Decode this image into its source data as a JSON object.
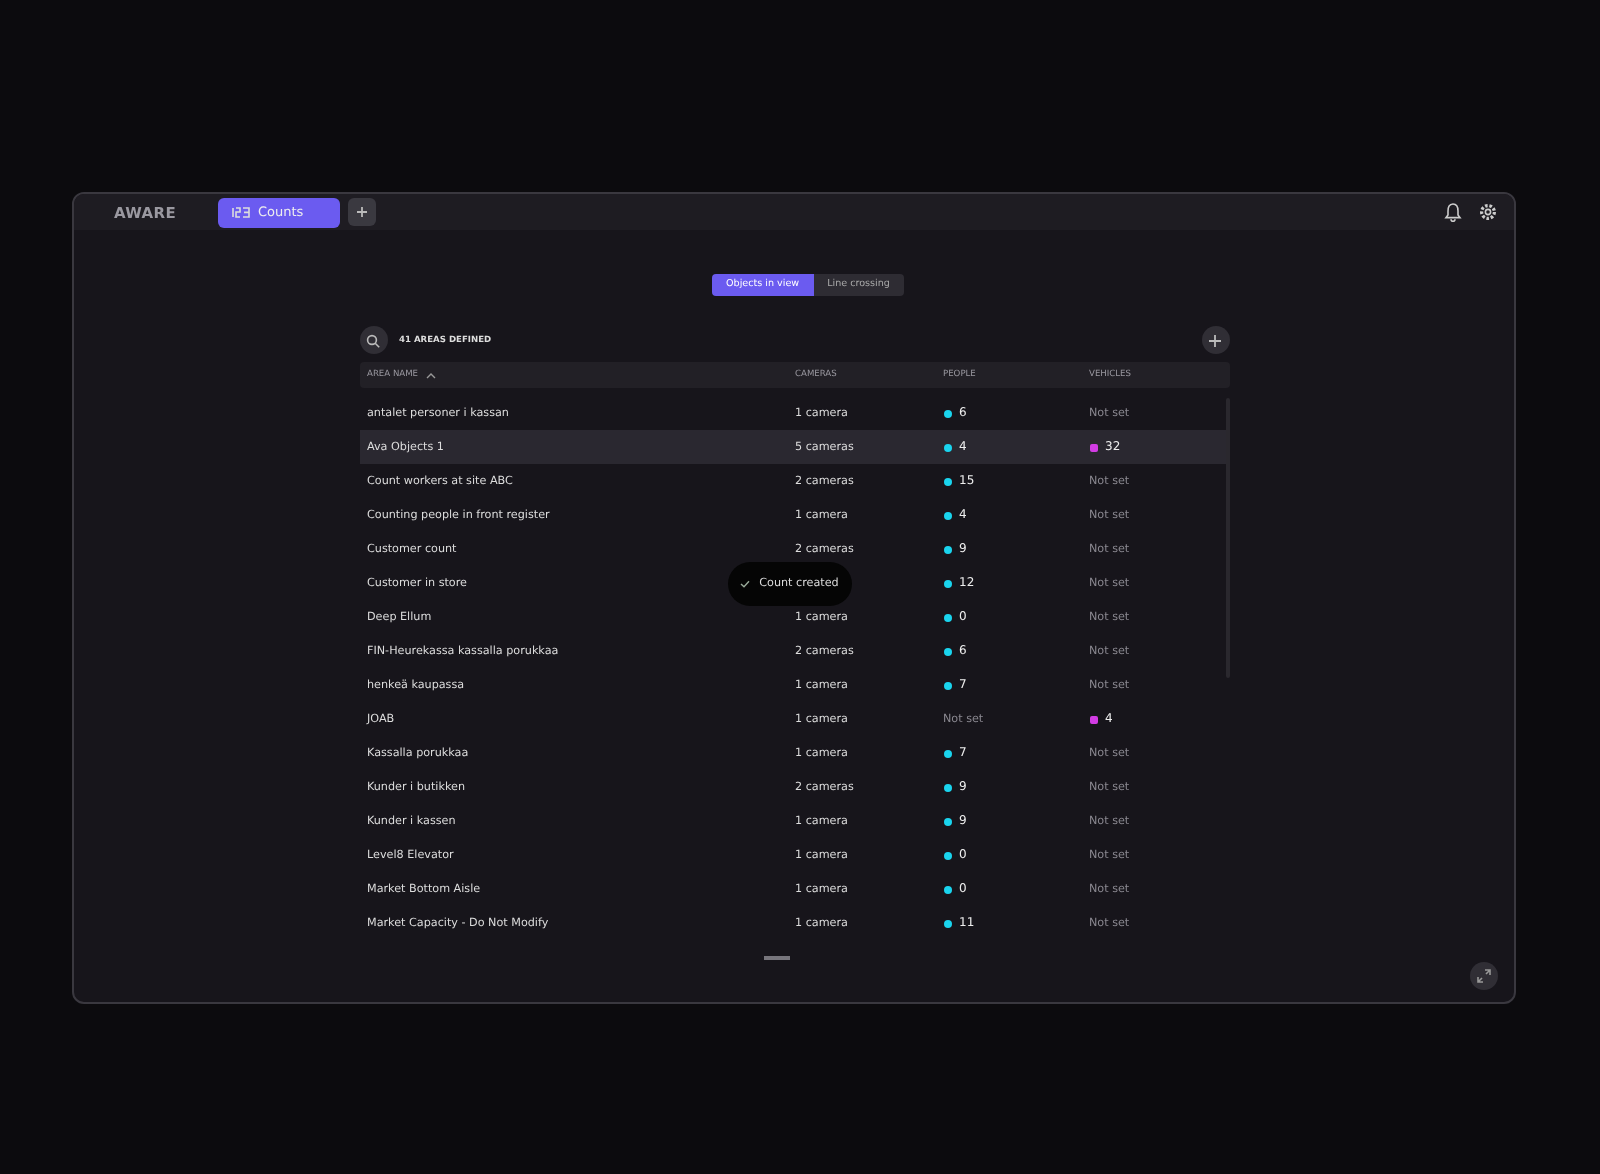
{
  "app": {
    "brand": "AWARE",
    "tabs": [
      {
        "label": "Counts",
        "selected": true
      }
    ]
  },
  "mode_toggle": [
    {
      "label": "Objects in view",
      "selected": true
    },
    {
      "label": "Line crossing",
      "selected": false
    }
  ],
  "summary": "41 AREAS DEFINED",
  "table": {
    "columns": [
      "AREA NAME",
      "CAMERAS",
      "PEOPLE",
      "VEHICLES"
    ],
    "rows": [
      {
        "name": "antalet personer i kassan",
        "cameras": "1 camera",
        "people": {
          "kind": "count",
          "text": "6"
        },
        "vehicles": {
          "kind": "unset",
          "text": "Not set"
        },
        "highlighted": false
      },
      {
        "name": "Ava Objects 1",
        "cameras": "5 cameras",
        "people": {
          "kind": "count",
          "text": "4"
        },
        "vehicles": {
          "kind": "count",
          "text": "32"
        },
        "highlighted": true
      },
      {
        "name": "Count workers at site ABC",
        "cameras": "2 cameras",
        "people": {
          "kind": "count",
          "text": "15"
        },
        "vehicles": {
          "kind": "unset",
          "text": "Not set"
        },
        "highlighted": false
      },
      {
        "name": "Counting people in front register",
        "cameras": "1 camera",
        "people": {
          "kind": "count",
          "text": "4"
        },
        "vehicles": {
          "kind": "unset",
          "text": "Not set"
        },
        "highlighted": false
      },
      {
        "name": "Customer count",
        "cameras": "2 cameras",
        "people": {
          "kind": "count",
          "text": "9"
        },
        "vehicles": {
          "kind": "unset",
          "text": "Not set"
        },
        "highlighted": false
      },
      {
        "name": "Customer in store",
        "people": {
          "kind": "count",
          "text": "12"
        },
        "vehicles": {
          "kind": "unset",
          "text": "Not set"
        },
        "highlighted": false
      },
      {
        "name": "Deep Ellum",
        "cameras": "1 camera",
        "people": {
          "kind": "count",
          "text": "0"
        },
        "vehicles": {
          "kind": "unset",
          "text": "Not set"
        },
        "highlighted": false
      },
      {
        "name": "FIN-Heurekassa kassalla porukkaa",
        "cameras": "2 cameras",
        "people": {
          "kind": "count",
          "text": "6"
        },
        "vehicles": {
          "kind": "unset",
          "text": "Not set"
        },
        "highlighted": false
      },
      {
        "name": "henkeä kaupassa",
        "cameras": "1 camera",
        "people": {
          "kind": "count",
          "text": "7"
        },
        "vehicles": {
          "kind": "unset",
          "text": "Not set"
        },
        "highlighted": false
      },
      {
        "name": "JOAB",
        "cameras": "1 camera",
        "people": {
          "kind": "unset",
          "text": "Not set"
        },
        "vehicles": {
          "kind": "count",
          "text": "4"
        },
        "highlighted": false
      },
      {
        "name": "Kassalla porukkaa",
        "cameras": "1 camera",
        "people": {
          "kind": "count",
          "text": "7"
        },
        "vehicles": {
          "kind": "unset",
          "text": "Not set"
        },
        "highlighted": false
      },
      {
        "name": "Kunder i butikken",
        "cameras": "2 cameras",
        "people": {
          "kind": "count",
          "text": "9"
        },
        "vehicles": {
          "kind": "unset",
          "text": "Not set"
        },
        "highlighted": false
      },
      {
        "name": "Kunder i kassen",
        "cameras": "1 camera",
        "people": {
          "kind": "count",
          "text": "9"
        },
        "vehicles": {
          "kind": "unset",
          "text": "Not set"
        },
        "highlighted": false
      },
      {
        "name": "Level8 Elevator",
        "cameras": "1 camera",
        "people": {
          "kind": "count",
          "text": "0"
        },
        "vehicles": {
          "kind": "unset",
          "text": "Not set"
        },
        "highlighted": false
      },
      {
        "name": "Market Bottom Aisle",
        "cameras": "1 camera",
        "people": {
          "kind": "count",
          "text": "0"
        },
        "vehicles": {
          "kind": "unset",
          "text": "Not set"
        },
        "highlighted": false
      },
      {
        "name": "Market Capacity - Do Not Modify",
        "cameras": "1 camera",
        "people": {
          "kind": "count",
          "text": "11"
        },
        "vehicles": {
          "kind": "unset",
          "text": "Not set"
        },
        "highlighted": false
      }
    ]
  },
  "toast": {
    "text": "Count created"
  }
}
